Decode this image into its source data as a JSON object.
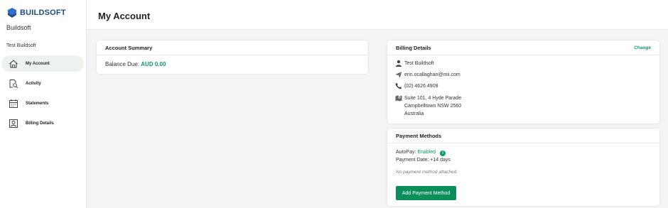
{
  "brand": {
    "name": "BUILDSOFT",
    "company": "Buildsoft",
    "color": "#1e4b8f"
  },
  "sidebar": {
    "user": "Test Buildsoft",
    "items": [
      {
        "label": "My Account",
        "icon": "home-icon",
        "active": true
      },
      {
        "label": "Activity",
        "icon": "activity-search-icon",
        "active": false
      },
      {
        "label": "Statements",
        "icon": "calendar-icon",
        "active": false
      },
      {
        "label": "Billing Details",
        "icon": "user-card-icon",
        "active": false
      }
    ]
  },
  "header": {
    "title": "My Account"
  },
  "summary": {
    "title": "Account Summary",
    "balance_label": "Balance Due:",
    "balance_amount": "AUD 0.00"
  },
  "billing": {
    "title": "Billing Details",
    "change_label": "Change",
    "name": "Test Buildsoft",
    "email": "erin.ocallaghan@mii.com",
    "phone": "(02) 4626 4909",
    "address_line1": "Suite 101, 4 Hyde Parade",
    "address_line2": "Campbelltown NSW 2560",
    "address_line3": "Australia"
  },
  "payment": {
    "title": "Payment Methods",
    "autopay_label": "AutoPay:",
    "autopay_status": "Enabled",
    "info_icon": "i",
    "payment_date": "Payment Date: +14 days",
    "no_method": "No payment method attached",
    "add_button": "Add Payment Method"
  },
  "colors": {
    "accent": "#0a9a64",
    "button": "#0a8f5b",
    "active_nav": "#eef2ef"
  }
}
